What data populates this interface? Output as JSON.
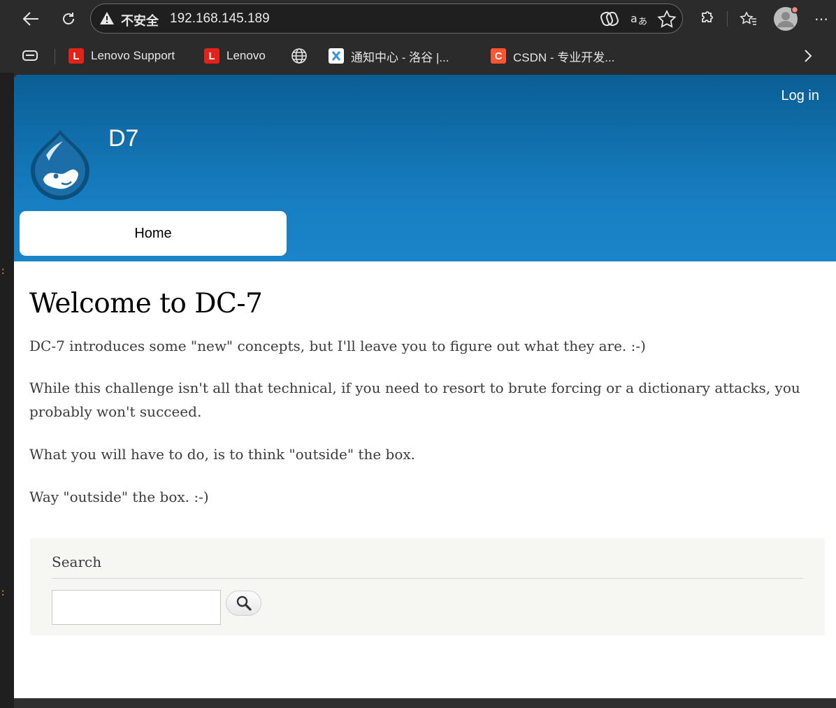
{
  "browser": {
    "insecure_label": "不安全",
    "url": "192.168.145.189"
  },
  "bookmarks": [
    {
      "label": "Lenovo Support",
      "icon": "lenovo-icon",
      "color": "#e2231a"
    },
    {
      "label": "Lenovo",
      "icon": "lenovo-icon",
      "color": "#e2231a"
    },
    {
      "label": "通知中心 - 洛谷 |...",
      "icon": "luogu-icon",
      "color": "#3498db"
    },
    {
      "label": "CSDN - 专业开发...",
      "icon": "csdn-icon",
      "color": "#fc5531"
    }
  ],
  "header": {
    "login": "Log in",
    "site_name": "D7",
    "nav_home": "Home"
  },
  "main": {
    "title": "Welcome to DC-7",
    "paragraphs": [
      "DC-7 introduces some \"new\" concepts, but I'll leave you to figure out what they are.  :-)",
      "While this challenge isn't all that technical, if you need to resort to brute forcing or a dictionary attacks, you probably won't succeed.",
      "What you will have to do, is to think \"outside\" the box.",
      "Way \"outside\" the box.  :-)"
    ]
  },
  "search": {
    "title": "Search",
    "value": ""
  },
  "colors": {
    "header_top": "#0a5e94",
    "header_bottom": "#1a84c8"
  }
}
